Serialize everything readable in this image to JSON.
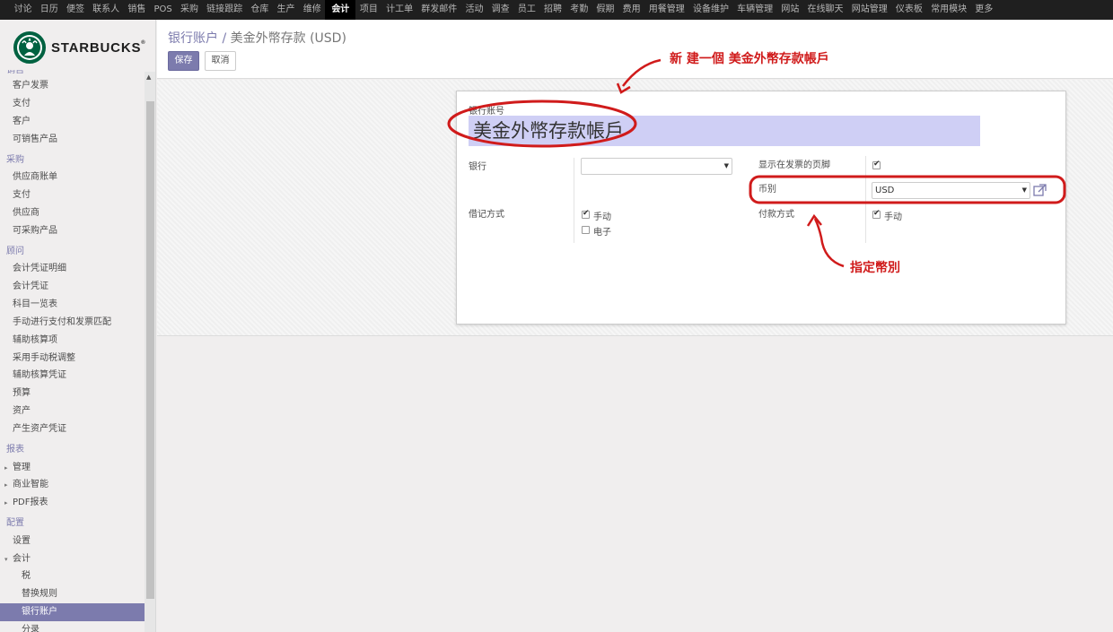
{
  "topnav": {
    "items": [
      "讨论",
      "日历",
      "便签",
      "联系人",
      "销售",
      "POS",
      "采购",
      "链接跟踪",
      "仓库",
      "生产",
      "维修",
      "会计",
      "项目",
      "计工单",
      "群发邮件",
      "活动",
      "调查",
      "员工",
      "招聘",
      "考勤",
      "假期",
      "费用",
      "用餐管理",
      "设备维护",
      "车辆管理",
      "网站",
      "在线聊天",
      "网站管理",
      "仪表板",
      "常用模块",
      "更多"
    ],
    "active": "会计"
  },
  "logo": {
    "text": "STARBUCKS",
    "tm": "®"
  },
  "sidebar": {
    "cut_item": "销售",
    "items": [
      {
        "label": "客户发票",
        "type": "item"
      },
      {
        "label": "支付",
        "type": "item"
      },
      {
        "label": "客户",
        "type": "item"
      },
      {
        "label": "可销售产品",
        "type": "item"
      },
      {
        "label": "采购",
        "type": "group"
      },
      {
        "label": "供应商账单",
        "type": "item"
      },
      {
        "label": "支付",
        "type": "item"
      },
      {
        "label": "供应商",
        "type": "item"
      },
      {
        "label": "可采购产品",
        "type": "item"
      },
      {
        "label": "顾问",
        "type": "group"
      },
      {
        "label": "会计凭证明细",
        "type": "item"
      },
      {
        "label": "会计凭证",
        "type": "item"
      },
      {
        "label": "科目一览表",
        "type": "item"
      },
      {
        "label": "手动进行支付和发票匹配",
        "type": "item"
      },
      {
        "label": "辅助核算项",
        "type": "item"
      },
      {
        "label": "采用手动税调整",
        "type": "item"
      },
      {
        "label": "辅助核算凭证",
        "type": "item"
      },
      {
        "label": "预算",
        "type": "item"
      },
      {
        "label": "资产",
        "type": "item"
      },
      {
        "label": "产生资产凭证",
        "type": "item"
      },
      {
        "label": "报表",
        "type": "group"
      },
      {
        "label": "管理",
        "type": "tri",
        "icon": "▸"
      },
      {
        "label": "商业智能",
        "type": "tri",
        "icon": "▸"
      },
      {
        "label": "PDF报表",
        "type": "tri",
        "icon": "▸"
      },
      {
        "label": "配置",
        "type": "group"
      },
      {
        "label": "设置",
        "type": "item"
      },
      {
        "label": "会计",
        "type": "tri",
        "icon": "▾"
      },
      {
        "label": "税",
        "type": "lvl2"
      },
      {
        "label": "替换规则",
        "type": "lvl2"
      },
      {
        "label": "银行账户",
        "type": "lvl2",
        "active": true
      },
      {
        "label": "分录",
        "type": "lvl2"
      }
    ]
  },
  "control": {
    "breadcrumb_parent": "银行账户",
    "breadcrumb_sep": "/",
    "breadcrumb_current": "美金外幣存款 (USD)",
    "save_label": "保存",
    "cancel_label": "取消"
  },
  "form": {
    "account_number_label": "银行账号",
    "account_number_value": "美金外幣存款帳戶",
    "bank_label": "银行",
    "bank_value": "",
    "posting_label": "借记方式",
    "posting_manual_label": "手动",
    "posting_manual_checked": true,
    "posting_electronic_label": "电子",
    "posting_electronic_checked": false,
    "show_footer_label": "显示在发票的页脚",
    "show_footer_checked": true,
    "currency_label": "币别",
    "currency_value": "USD",
    "payment_method_label": "付款方式",
    "payment_manual_label": "手动",
    "payment_manual_checked": true
  },
  "annotations": {
    "new_account": "新 建一個 美金外幣存款帳戶",
    "currency": "指定幣別",
    "color": "#d01b1b"
  }
}
